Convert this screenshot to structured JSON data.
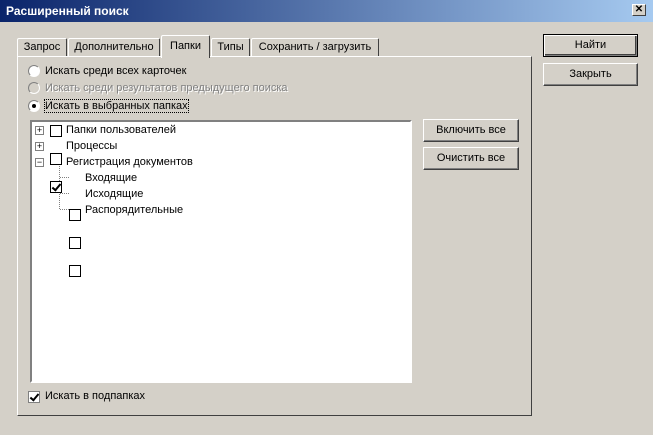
{
  "window": {
    "title": "Расширенный поиск",
    "close_symbol": "✕"
  },
  "tabs": [
    {
      "label": "Запрос"
    },
    {
      "label": "Дополнительно"
    },
    {
      "label": "Папки",
      "active": true
    },
    {
      "label": "Типы"
    },
    {
      "label": "Сохранить / загрузить"
    }
  ],
  "scope": {
    "options": [
      {
        "label": "Искать среди всех карточек",
        "selected": false,
        "enabled": true
      },
      {
        "label": "Искать среди результатов предыдущего поиска",
        "selected": false,
        "enabled": false
      },
      {
        "label": "Искать в выбранных папках",
        "selected": true,
        "enabled": true
      }
    ]
  },
  "tree": {
    "items": [
      {
        "label": "Папки пользователей",
        "checked": false,
        "expander": "+"
      },
      {
        "label": "Процессы",
        "checked": false,
        "expander": "+"
      },
      {
        "label": "Регистрация документов",
        "checked": true,
        "expander": "−"
      },
      {
        "label": "Входящие",
        "checked": false
      },
      {
        "label": "Исходящие",
        "checked": false
      },
      {
        "label": "Распорядительные",
        "checked": false
      }
    ]
  },
  "side_buttons": {
    "select_all": "Включить все",
    "clear_all": "Очистить все"
  },
  "subfolders": {
    "label": "Искать в подпапках",
    "checked": true
  },
  "dialog_buttons": {
    "find": "Найти",
    "close": "Закрыть"
  }
}
